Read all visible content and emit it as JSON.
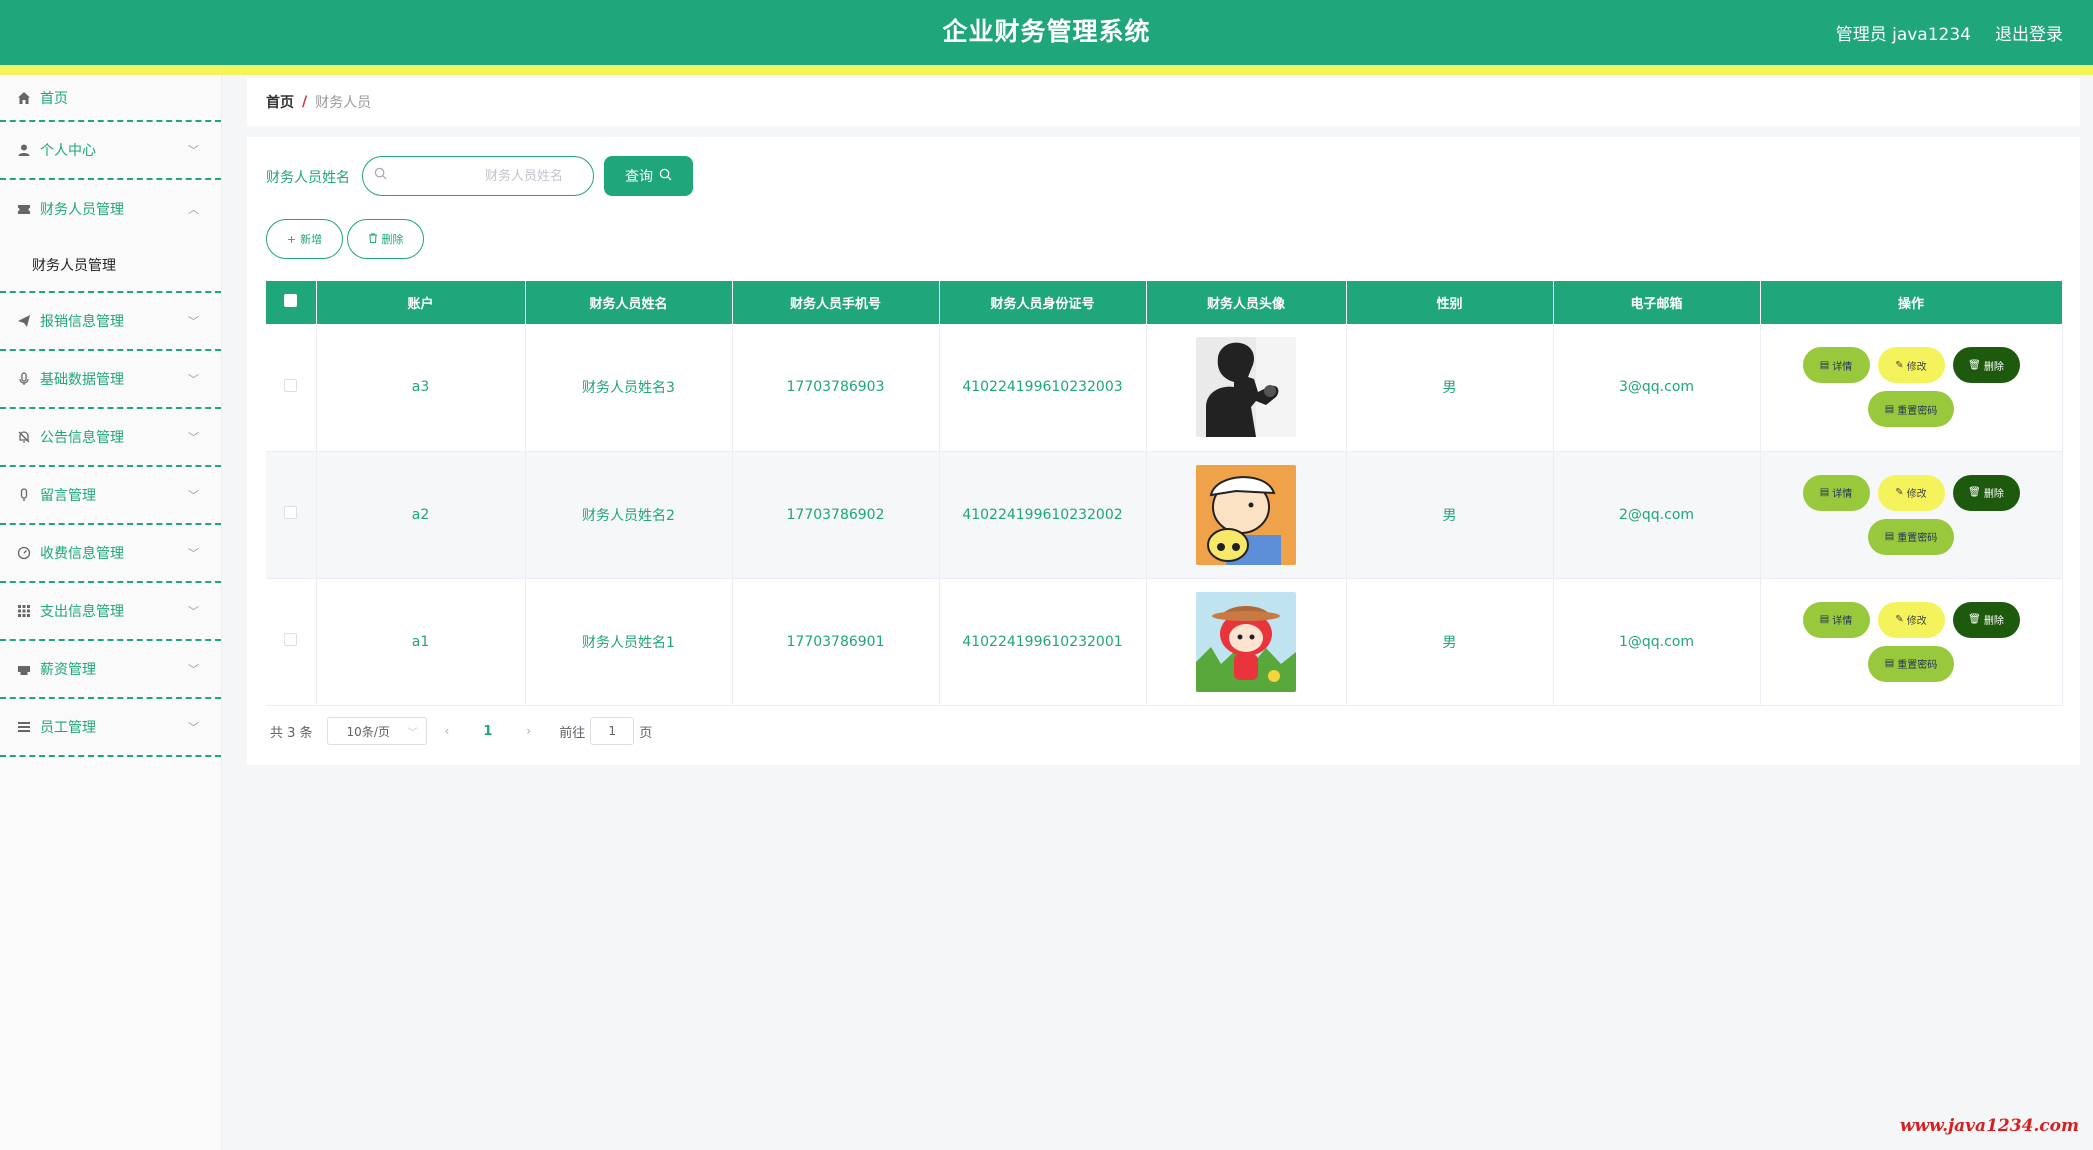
{
  "header": {
    "title": "企业财务管理系统",
    "user": "管理员 java1234",
    "logout": "退出登录"
  },
  "colors": {
    "primary": "#1fa67a",
    "stripe": "#f3f35a",
    "detail_btn": "#98c93c",
    "edit_btn": "#f5f35c",
    "delete_btn": "#1e5a0e"
  },
  "sidebar": {
    "items": [
      {
        "label": "首页",
        "icon": "home-icon"
      },
      {
        "label": "个人中心",
        "icon": "user-icon"
      },
      {
        "label": "财务人员管理",
        "icon": "ticket-icon",
        "sub": "财务人员管理"
      },
      {
        "label": "报销信息管理",
        "icon": "send-icon"
      },
      {
        "label": "基础数据管理",
        "icon": "mic-icon"
      },
      {
        "label": "公告信息管理",
        "icon": "bell-off-icon"
      },
      {
        "label": "留言管理",
        "icon": "microphone-icon"
      },
      {
        "label": "收费信息管理",
        "icon": "gauge-icon"
      },
      {
        "label": "支出信息管理",
        "icon": "grid-icon"
      },
      {
        "label": "薪资管理",
        "icon": "printer-icon"
      },
      {
        "label": "员工管理",
        "icon": "menu-icon"
      }
    ]
  },
  "breadcrumb": {
    "home": "首页",
    "separator": "/",
    "current": "财务人员"
  },
  "search": {
    "label": "财务人员姓名",
    "placeholder": "财务人员姓名",
    "button": "查询"
  },
  "actions": {
    "add": "新增",
    "delete": "删除"
  },
  "table": {
    "headers": [
      "账户",
      "财务人员姓名",
      "财务人员手机号",
      "财务人员身份证号",
      "财务人员头像",
      "性别",
      "电子邮箱",
      "操作"
    ],
    "rows": [
      {
        "account": "a3",
        "name": "财务人员姓名3",
        "phone": "17703786903",
        "id_card": "410224199610232003",
        "avatar": "man-silhouette-avatar",
        "gender": "男",
        "email": "3@qq.com"
      },
      {
        "account": "a2",
        "name": "财务人员姓名2",
        "phone": "17703786902",
        "id_card": "410224199610232002",
        "avatar": "cartoon-boy-avatar",
        "gender": "男",
        "email": "2@qq.com"
      },
      {
        "account": "a1",
        "name": "财务人员姓名1",
        "phone": "17703786901",
        "id_card": "410224199610232001",
        "avatar": "cartoon-girl-avatar",
        "gender": "男",
        "email": "1@qq.com"
      }
    ],
    "ops": {
      "detail": "详情",
      "edit": "修改",
      "delete": "删除",
      "reset": "重置密码"
    }
  },
  "pagination": {
    "total": "共 3 条",
    "page_size": "10条/页",
    "current": "1",
    "goto_label": "前往",
    "goto_value": "1",
    "page_unit": "页"
  },
  "watermark": "www.java1234.com"
}
